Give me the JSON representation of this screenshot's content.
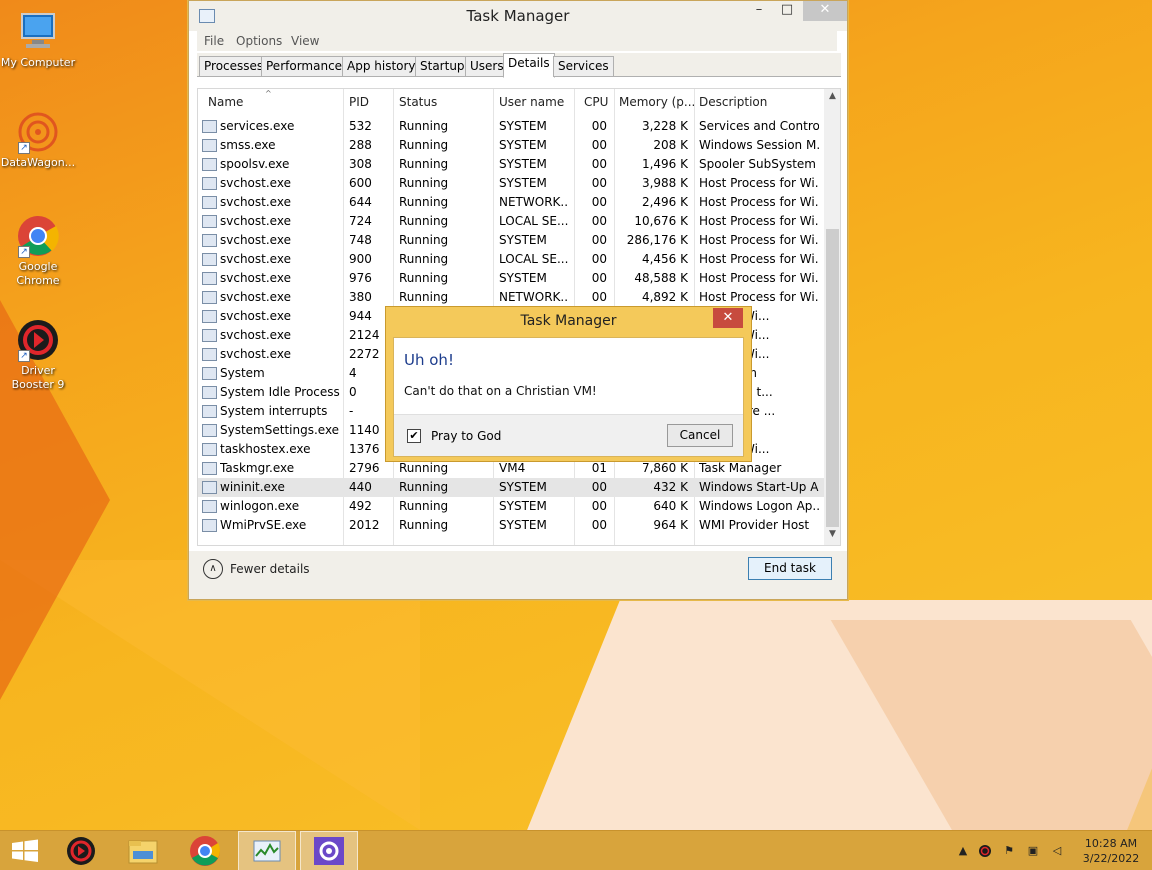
{
  "desktop": {
    "icons": [
      {
        "label": "My Computer",
        "icon": "computer-icon"
      },
      {
        "label": "DataWagon...",
        "icon": "datawagon-icon"
      },
      {
        "label": "Google Chrome",
        "icon": "chrome-icon"
      },
      {
        "label": "Driver Booster 9",
        "icon": "driver-booster-icon"
      }
    ]
  },
  "task_manager": {
    "title": "Task Manager",
    "window_buttons": {
      "minimize": "–",
      "maximize": "□",
      "close": "✕"
    },
    "menu": [
      "File",
      "Options",
      "View"
    ],
    "tabs": [
      "Processes",
      "Performance",
      "App history",
      "Startup",
      "Users",
      "Details",
      "Services"
    ],
    "active_tab": "Details",
    "columns": [
      "Name",
      "PID",
      "Status",
      "User name",
      "CPU",
      "Memory (p...",
      "Description"
    ],
    "rows": [
      {
        "name": "services.exe",
        "pid": "532",
        "status": "Running",
        "user": "SYSTEM",
        "cpu": "00",
        "mem": "3,228 K",
        "desc": "Services and Control..."
      },
      {
        "name": "smss.exe",
        "pid": "288",
        "status": "Running",
        "user": "SYSTEM",
        "cpu": "00",
        "mem": "208 K",
        "desc": "Windows Session M..."
      },
      {
        "name": "spoolsv.exe",
        "pid": "308",
        "status": "Running",
        "user": "SYSTEM",
        "cpu": "00",
        "mem": "1,496 K",
        "desc": "Spooler SubSystem ..."
      },
      {
        "name": "svchost.exe",
        "pid": "600",
        "status": "Running",
        "user": "SYSTEM",
        "cpu": "00",
        "mem": "3,988 K",
        "desc": "Host Process for Wi..."
      },
      {
        "name": "svchost.exe",
        "pid": "644",
        "status": "Running",
        "user": "NETWORK...",
        "cpu": "00",
        "mem": "2,496 K",
        "desc": "Host Process for Wi..."
      },
      {
        "name": "svchost.exe",
        "pid": "724",
        "status": "Running",
        "user": "LOCAL SE...",
        "cpu": "00",
        "mem": "10,676 K",
        "desc": "Host Process for Wi..."
      },
      {
        "name": "svchost.exe",
        "pid": "748",
        "status": "Running",
        "user": "SYSTEM",
        "cpu": "00",
        "mem": "286,176 K",
        "desc": "Host Process for Wi..."
      },
      {
        "name": "svchost.exe",
        "pid": "900",
        "status": "Running",
        "user": "LOCAL SE...",
        "cpu": "00",
        "mem": "4,456 K",
        "desc": "Host Process for Wi..."
      },
      {
        "name": "svchost.exe",
        "pid": "976",
        "status": "Running",
        "user": "SYSTEM",
        "cpu": "00",
        "mem": "48,588 K",
        "desc": "Host Process for Wi..."
      },
      {
        "name": "svchost.exe",
        "pid": "380",
        "status": "Running",
        "user": "NETWORK...",
        "cpu": "00",
        "mem": "4,892 K",
        "desc": "Host Process for Wi..."
      },
      {
        "name": "svchost.exe",
        "pid": "944",
        "status": "",
        "user": "",
        "cpu": "",
        "mem": "",
        "desc": "ess for Wi..."
      },
      {
        "name": "svchost.exe",
        "pid": "2124",
        "status": "",
        "user": "",
        "cpu": "",
        "mem": "",
        "desc": "ess for Wi..."
      },
      {
        "name": "svchost.exe",
        "pid": "2272",
        "status": "",
        "user": "",
        "cpu": "",
        "mem": "",
        "desc": "ess for Wi..."
      },
      {
        "name": "System",
        "pid": "4",
        "status": "",
        "user": "",
        "cpu": "",
        "mem": "",
        "desc": "& System"
      },
      {
        "name": "System Idle Process",
        "pid": "0",
        "status": "",
        "user": "",
        "cpu": "",
        "mem": "",
        "desc": "e of time t..."
      },
      {
        "name": "System interrupts",
        "pid": "-",
        "status": "",
        "user": "",
        "cpu": "",
        "mem": "",
        "desc": "procedure ..."
      },
      {
        "name": "SystemSettings.exe",
        "pid": "1140",
        "status": "",
        "user": "",
        "cpu": "",
        "mem": "",
        "desc": "s"
      },
      {
        "name": "taskhostex.exe",
        "pid": "1376",
        "status": "",
        "user": "",
        "cpu": "",
        "mem": "",
        "desc": "ess for Wi..."
      },
      {
        "name": "Taskmgr.exe",
        "pid": "2796",
        "status": "Running",
        "user": "VM4",
        "cpu": "01",
        "mem": "7,860 K",
        "desc": "Task Manager"
      },
      {
        "name": "wininit.exe",
        "pid": "440",
        "status": "Running",
        "user": "SYSTEM",
        "cpu": "00",
        "mem": "432 K",
        "desc": "Windows Start-Up A..."
      },
      {
        "name": "winlogon.exe",
        "pid": "492",
        "status": "Running",
        "user": "SYSTEM",
        "cpu": "00",
        "mem": "640 K",
        "desc": "Windows Logon Ap..."
      },
      {
        "name": "WmiPrvSE.exe",
        "pid": "2012",
        "status": "Running",
        "user": "SYSTEM",
        "cpu": "00",
        "mem": "964 K",
        "desc": "WMI Provider Host"
      }
    ],
    "highlighted_row": 19,
    "fewer_details": "Fewer details",
    "end_task": "End task"
  },
  "dialog": {
    "title": "Task Manager",
    "heading": "Uh oh!",
    "message": "Can't do that on a Christian VM!",
    "checkbox_label": "Pray to God",
    "checkbox_checked": true,
    "cancel": "Cancel",
    "close": "✕"
  },
  "taskbar": {
    "apps": [
      "start-icon",
      "driver-booster-icon",
      "file-explorer-icon",
      "chrome-icon",
      "task-manager-icon",
      "settings-icon"
    ],
    "clock_time": "10:28 AM",
    "clock_date": "3/22/2022"
  },
  "colors": {
    "accent": "#f4c95a",
    "dialog_heading": "#1c3c8c",
    "taskbar": "#d8a43c"
  }
}
